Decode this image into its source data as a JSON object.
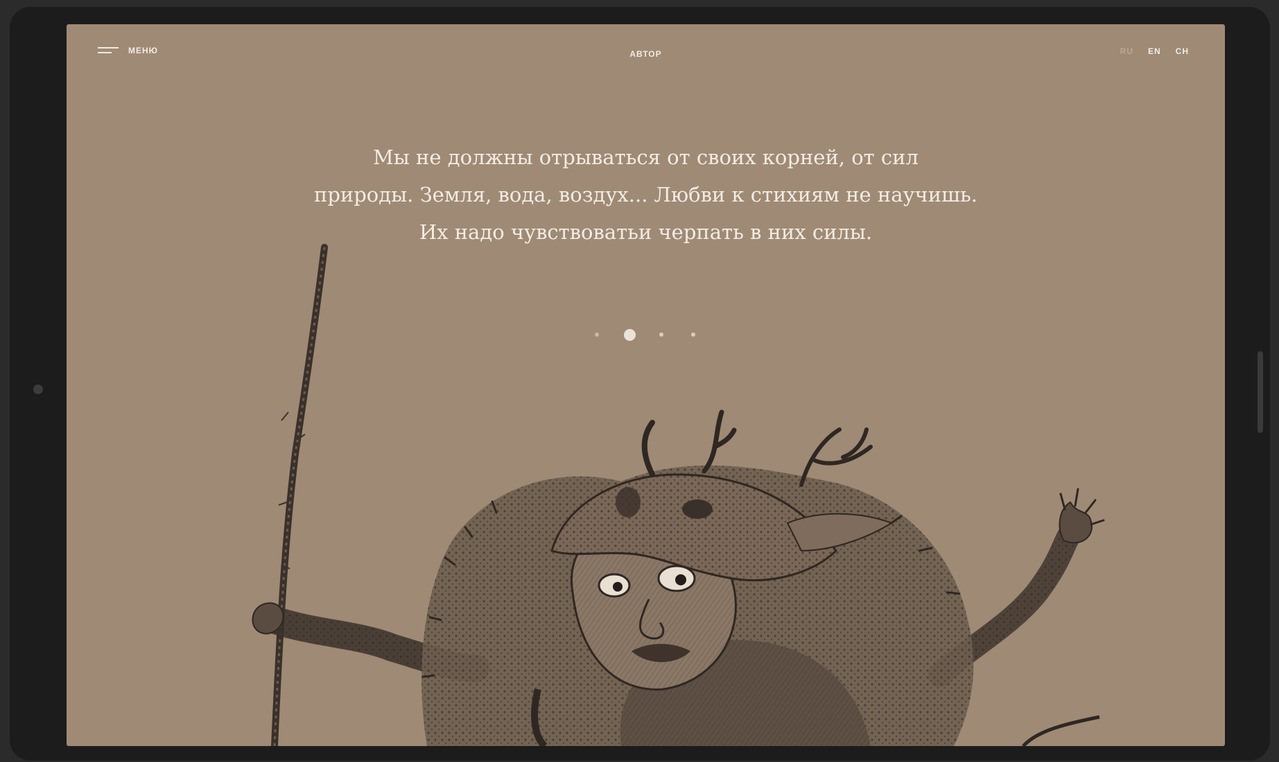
{
  "nav": {
    "menu_label": "МЕНЮ",
    "author_label": "АВТОР",
    "languages": [
      "RU",
      "EN",
      "CH"
    ]
  },
  "quote": {
    "lines": [
      "Мы не должны отрываться от своих корней, от сил",
      "природы. Земля, вода, воздух... Любви к стихиям не научишь.",
      "Их надо чувствоватьи черпать в них силы."
    ]
  },
  "slider": {
    "total_slides": 4,
    "active_index": 1
  },
  "colors": {
    "screen_bg": "#9f8a75",
    "text": "#f3ece4",
    "ink": "#3a302a"
  },
  "icons": {
    "menu": "hamburger-icon"
  }
}
